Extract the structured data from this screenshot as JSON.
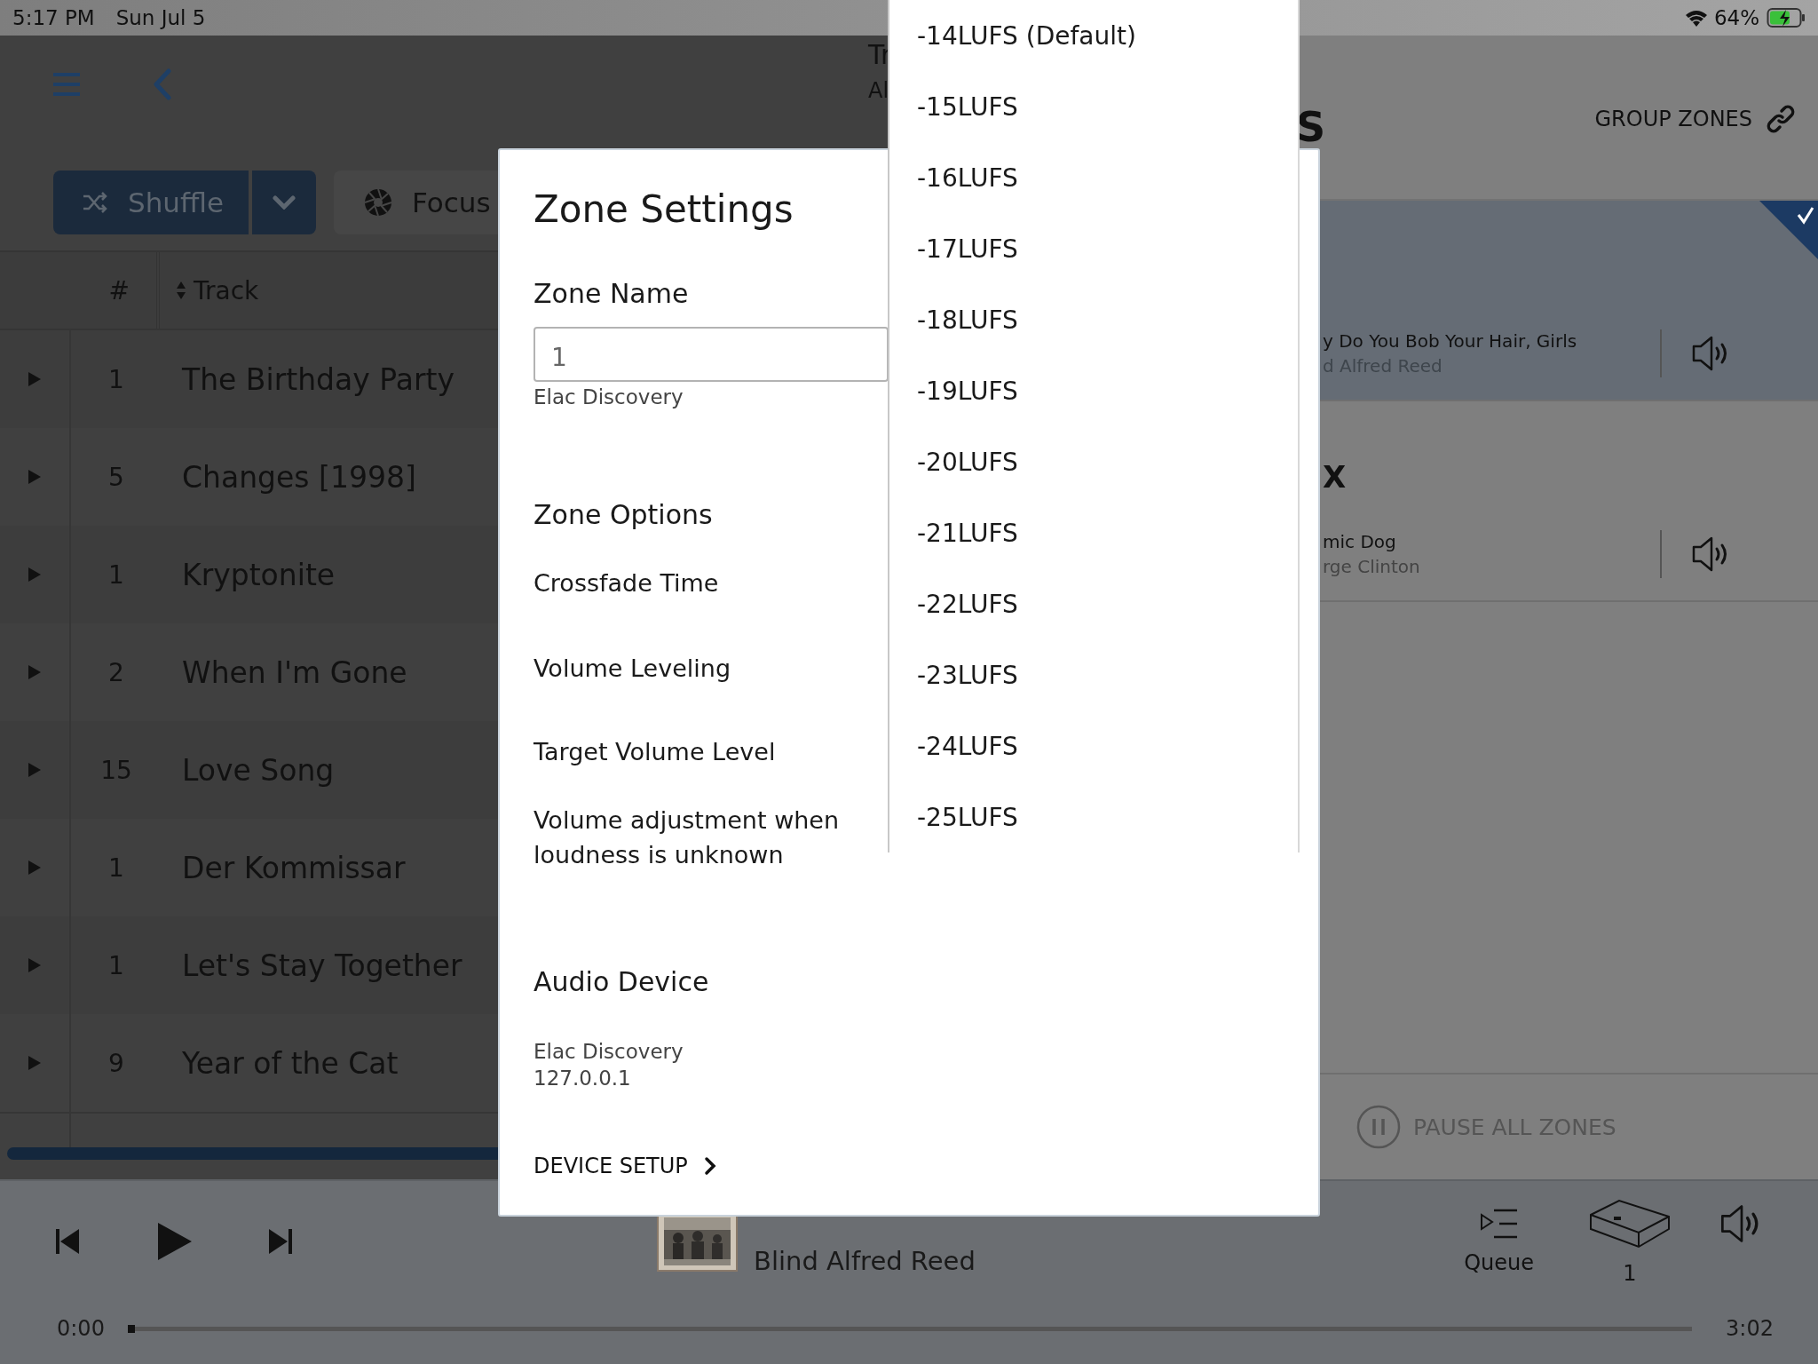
{
  "status_bar": {
    "time": "5:17 PM",
    "date": "Sun Jul 5",
    "battery": "64%"
  },
  "library": {
    "title": "Tr",
    "subtitle": "Al",
    "shuffle": "Shuffle",
    "focus": "Focus",
    "columns": [
      "#",
      "Track"
    ],
    "rows": [
      {
        "number": "1",
        "title": "The Birthday Party"
      },
      {
        "number": "5",
        "title": "Changes [1998]"
      },
      {
        "number": "1",
        "title": "Kryptonite"
      },
      {
        "number": "2",
        "title": "When I'm Gone"
      },
      {
        "number": "15",
        "title": "Love Song"
      },
      {
        "number": "1",
        "title": "Der Kommissar"
      },
      {
        "number": "1",
        "title": "Let's Stay Together"
      },
      {
        "number": "9",
        "title": "Year of the Cat"
      }
    ]
  },
  "zones": {
    "heading": "S",
    "group_button": "GROUP ZONES",
    "items": [
      {
        "track": "y Do You Bob Your Hair, Girls",
        "artist": "d Alfred Reed",
        "selected": true
      },
      {
        "name": "X",
        "track": "mic Dog",
        "artist": "rge Clinton",
        "selected": false
      }
    ],
    "pause_all": "PAUSE ALL ZONES"
  },
  "player": {
    "artist": "Blind Alfred Reed",
    "queue": "Queue",
    "zone_count": "1",
    "elapsed": "0:00",
    "duration": "3:02",
    "level": 0
  },
  "zone_settings": {
    "title": "Zone Settings",
    "zone_name_label": "Zone Name",
    "zone_name_value": "1",
    "zone_name_caption": "Elac Discovery",
    "options_heading": "Zone Options",
    "options": [
      "Crossfade Time",
      "Volume Leveling",
      "Target Volume Level",
      "Volume adjustment when loudness is unknown"
    ],
    "audio_device_heading": "Audio Device",
    "device_name": "Elac Discovery",
    "device_address": "127.0.0.1",
    "device_setup": "DEVICE SETUP"
  },
  "volume_dropdown": {
    "options": [
      "-14LUFS (Default)",
      "-15LUFS",
      "-16LUFS",
      "-17LUFS",
      "-18LUFS",
      "-19LUFS",
      "-20LUFS",
      "-21LUFS",
      "-22LUFS",
      "-23LUFS",
      "-24LUFS",
      "-25LUFS"
    ]
  }
}
